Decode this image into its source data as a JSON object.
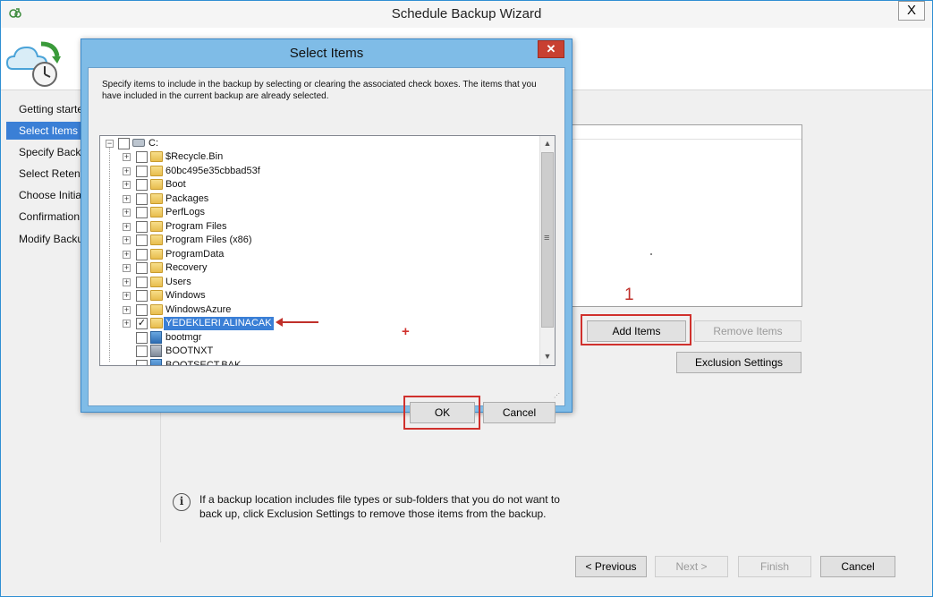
{
  "wizard": {
    "title": "Schedule Backup Wizard",
    "close_glyph": "X",
    "steps": [
      {
        "label": "Getting started",
        "active": false
      },
      {
        "label": "Select Items to Backup",
        "active": true
      },
      {
        "label": "Specify Backup Time",
        "active": false
      },
      {
        "label": "Select Retention Policy",
        "active": false
      },
      {
        "label": "Choose Initial Backup Type",
        "active": false
      },
      {
        "label": "Confirmation",
        "active": false
      },
      {
        "label": "Modify Backup Progress",
        "active": false
      }
    ],
    "buttons": {
      "add_items": "Add Items",
      "remove_items": "Remove Items",
      "exclusion_settings": "Exclusion Settings",
      "previous": "< Previous",
      "next": "Next >",
      "finish": "Finish",
      "cancel": "Cancel"
    },
    "info_text": "If a backup location includes file types or sub-folders that you do not want to back up, click Exclusion Settings to remove those items from the backup.",
    "info_glyph": "i"
  },
  "dialog": {
    "title": "Select Items",
    "close_glyph": "✕",
    "description": "Specify items to include in the backup by selecting or clearing the associated check boxes. The items that you have included in the current backup are already selected.",
    "root": {
      "label": "C:",
      "expander": "⊟"
    },
    "items": [
      {
        "label": "$Recycle.Bin",
        "kind": "folder",
        "checked": false,
        "expandable": true,
        "selected": false
      },
      {
        "label": "60bc495e35cbbad53f",
        "kind": "folder",
        "checked": false,
        "expandable": true,
        "selected": false
      },
      {
        "label": "Boot",
        "kind": "folder",
        "checked": false,
        "expandable": true,
        "selected": false
      },
      {
        "label": "Packages",
        "kind": "folder",
        "checked": false,
        "expandable": true,
        "selected": false
      },
      {
        "label": "PerfLogs",
        "kind": "folder",
        "checked": false,
        "expandable": true,
        "selected": false
      },
      {
        "label": "Program Files",
        "kind": "folder",
        "checked": false,
        "expandable": true,
        "selected": false
      },
      {
        "label": "Program Files (x86)",
        "kind": "folder",
        "checked": false,
        "expandable": true,
        "selected": false
      },
      {
        "label": "ProgramData",
        "kind": "folder",
        "checked": false,
        "expandable": true,
        "selected": false
      },
      {
        "label": "Recovery",
        "kind": "folder",
        "checked": false,
        "expandable": true,
        "selected": false
      },
      {
        "label": "Users",
        "kind": "folder",
        "checked": false,
        "expandable": true,
        "selected": false
      },
      {
        "label": "Windows",
        "kind": "folder",
        "checked": false,
        "expandable": true,
        "selected": false
      },
      {
        "label": "WindowsAzure",
        "kind": "folder",
        "checked": false,
        "expandable": true,
        "selected": false
      },
      {
        "label": "YEDEKLERI ALINACAK",
        "kind": "folder",
        "checked": true,
        "expandable": true,
        "selected": true
      },
      {
        "label": "bootmgr",
        "kind": "file",
        "checked": false,
        "expandable": false,
        "selected": false
      },
      {
        "label": "BOOTNXT",
        "kind": "file",
        "checked": false,
        "expandable": false,
        "selected": false
      },
      {
        "label": "BOOTSECT.BAK",
        "kind": "file",
        "checked": false,
        "expandable": false,
        "selected": false
      }
    ],
    "check_glyph": "✓",
    "expand_glyph": "+",
    "buttons": {
      "ok": "OK",
      "cancel": "Cancel"
    },
    "scroll": {
      "up": "▲",
      "down": "▼",
      "grip": "≡"
    }
  },
  "annotations": {
    "number": "1",
    "plus": "+"
  },
  "colors": {
    "selection": "#3a7fd6",
    "dialog_frame": "#7fbce7",
    "annotation_red": "#d0312d"
  }
}
